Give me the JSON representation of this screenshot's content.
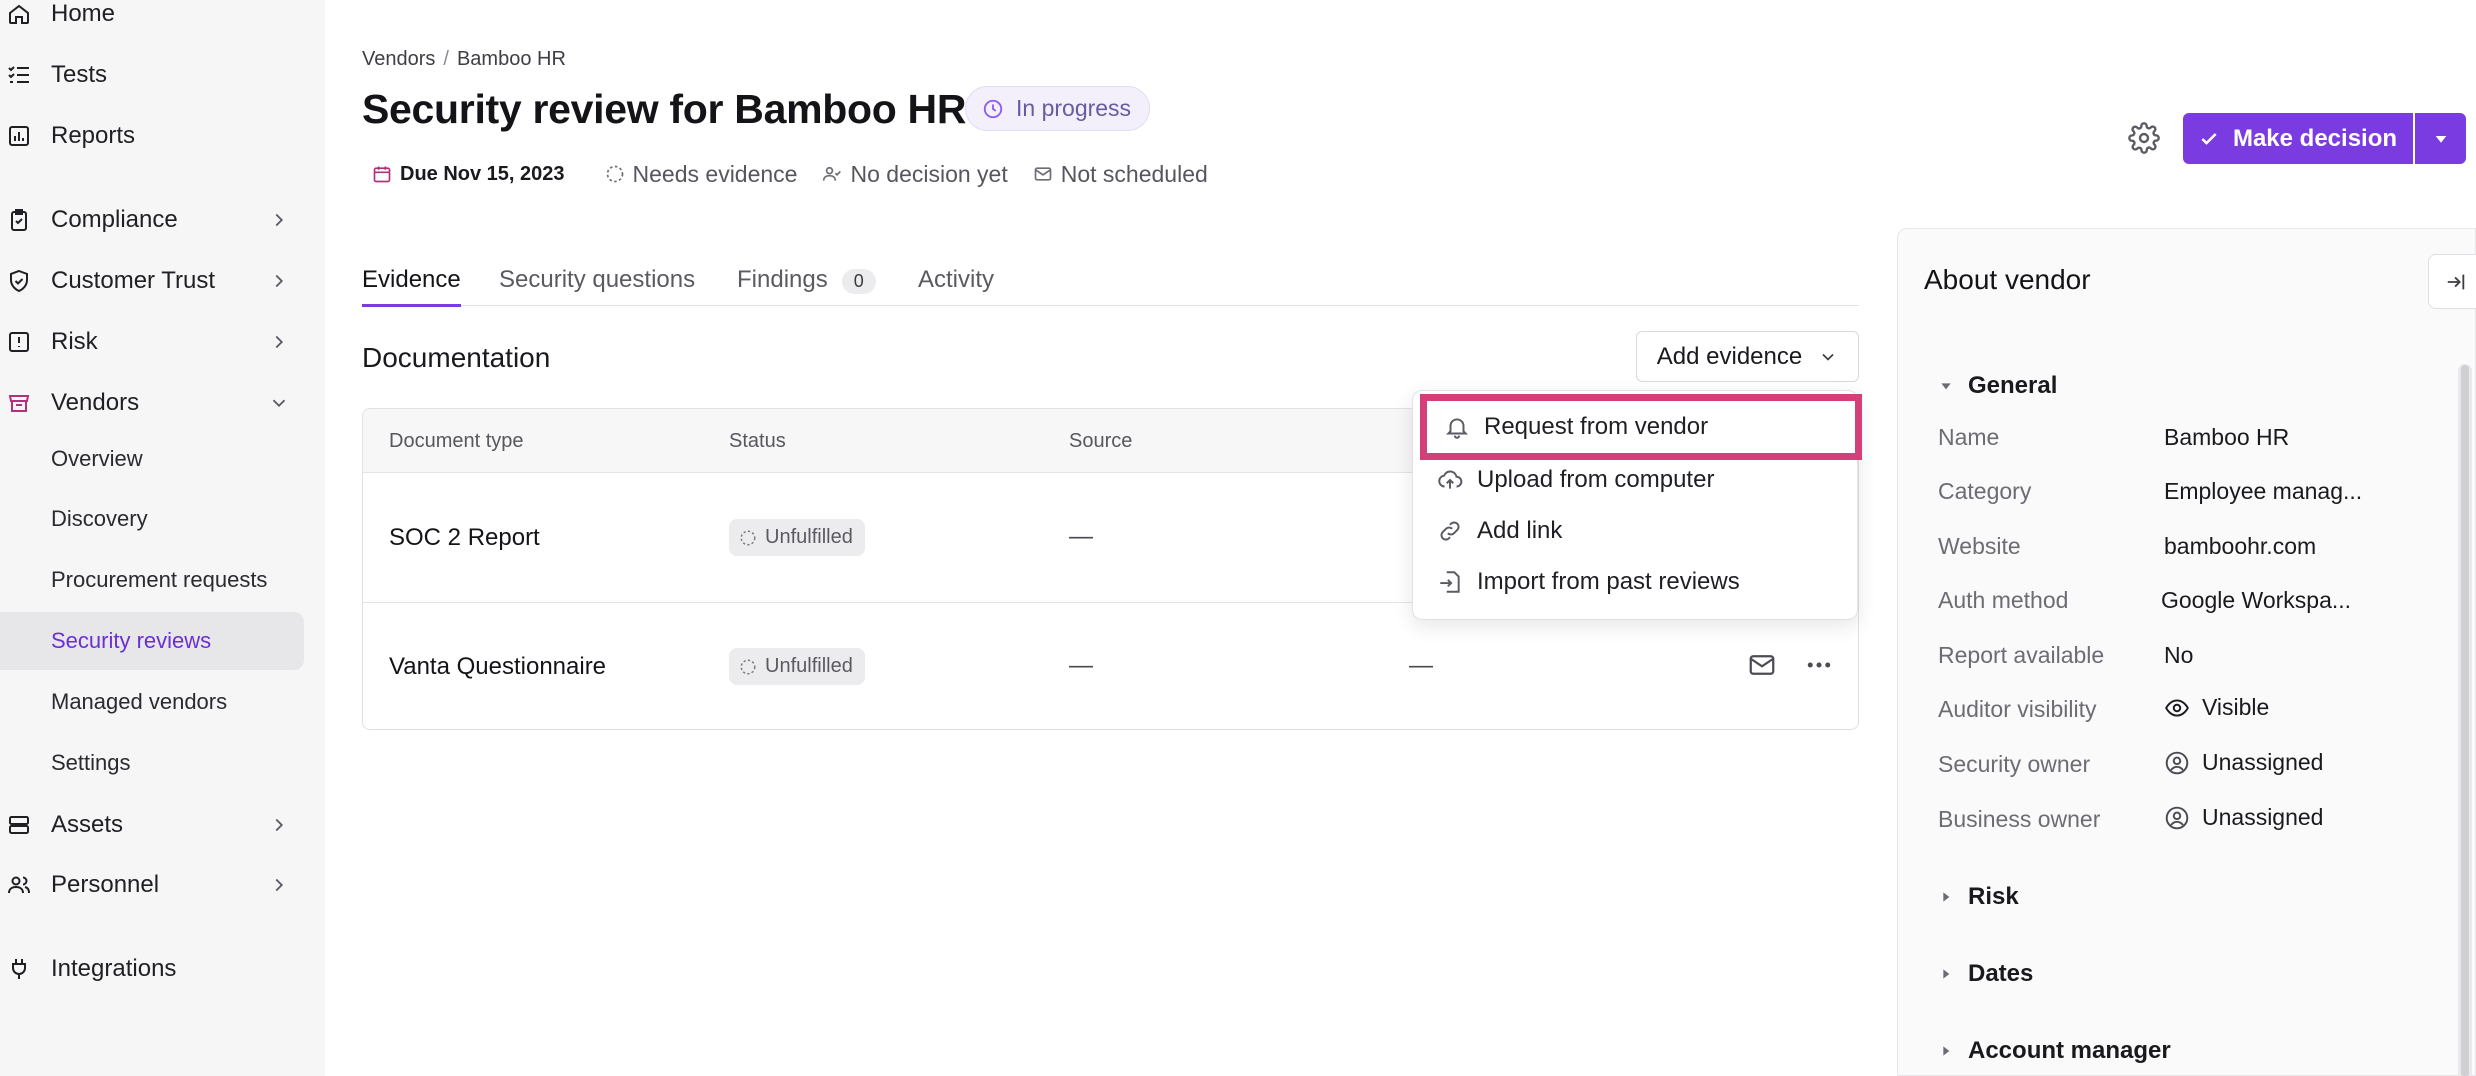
{
  "sidebar": {
    "items": [
      {
        "label": "Home",
        "icon": "home-icon"
      },
      {
        "label": "Tests",
        "icon": "tests-icon"
      },
      {
        "label": "Reports",
        "icon": "reports-icon"
      },
      {
        "label": "Compliance",
        "icon": "compliance-icon"
      },
      {
        "label": "Customer Trust",
        "icon": "shield-check-icon"
      },
      {
        "label": "Risk",
        "icon": "risk-icon"
      },
      {
        "label": "Vendors",
        "icon": "vendors-icon"
      },
      {
        "label": "Assets",
        "icon": "assets-icon"
      },
      {
        "label": "Personnel",
        "icon": "personnel-icon"
      },
      {
        "label": "Integrations",
        "icon": "plug-icon"
      }
    ],
    "vendor_subitems": [
      "Overview",
      "Discovery",
      "Procurement requests",
      "Security reviews",
      "Managed vendors",
      "Settings"
    ],
    "active_subitem": "Security reviews"
  },
  "breadcrumb": {
    "parent": "Vendors",
    "separator": "/",
    "current": "Bamboo HR"
  },
  "header": {
    "title": "Security review for Bamboo HR",
    "status": "In progress",
    "due": "Due Nov 15, 2023",
    "evidence_status": "Needs evidence",
    "decision_status": "No decision yet",
    "schedule_status": "Not scheduled",
    "make_decision_label": "Make decision"
  },
  "tabs": [
    {
      "label": "Evidence",
      "active": true
    },
    {
      "label": "Security questions"
    },
    {
      "label": "Findings",
      "count": "0"
    },
    {
      "label": "Activity"
    }
  ],
  "documentation": {
    "title": "Documentation",
    "add_evidence_label": "Add evidence",
    "columns": [
      "Document type",
      "Status",
      "Source"
    ],
    "rows": [
      {
        "document": "SOC 2 Report",
        "status": "Unfulfilled",
        "source": "—",
        "extra": "—"
      },
      {
        "document": "Vanta Questionnaire",
        "status": "Unfulfilled",
        "source": "—",
        "extra": "—"
      }
    ]
  },
  "add_evidence_menu": {
    "items": [
      {
        "label": "Request from vendor",
        "icon": "bell-icon",
        "highlighted": true
      },
      {
        "label": "Upload from computer",
        "icon": "cloud-upload-icon"
      },
      {
        "label": "Add link",
        "icon": "link-icon"
      },
      {
        "label": "Import from past reviews",
        "icon": "import-icon"
      }
    ]
  },
  "about_vendor": {
    "title": "About vendor",
    "general_label": "General",
    "fields": [
      {
        "label": "Name",
        "value": "Bamboo HR"
      },
      {
        "label": "Category",
        "value": "Employee manag..."
      },
      {
        "label": "Website",
        "value": "bamboohr.com"
      },
      {
        "label": "Auth method",
        "value": "Google Workspa..."
      },
      {
        "label": "Report available",
        "value": "No"
      },
      {
        "label": "Auditor visibility",
        "value": "Visible",
        "icon": "eye-icon"
      },
      {
        "label": "Security owner",
        "value": "Unassigned",
        "icon": "user-circle-icon"
      },
      {
        "label": "Business owner",
        "value": "Unassigned",
        "icon": "user-circle-icon"
      }
    ],
    "sections": [
      "Risk",
      "Dates",
      "Account manager"
    ]
  },
  "colors": {
    "accent": "#7a3ce0",
    "highlight_border": "#d43f7a",
    "sidebar_bg": "#f6f6f7"
  }
}
